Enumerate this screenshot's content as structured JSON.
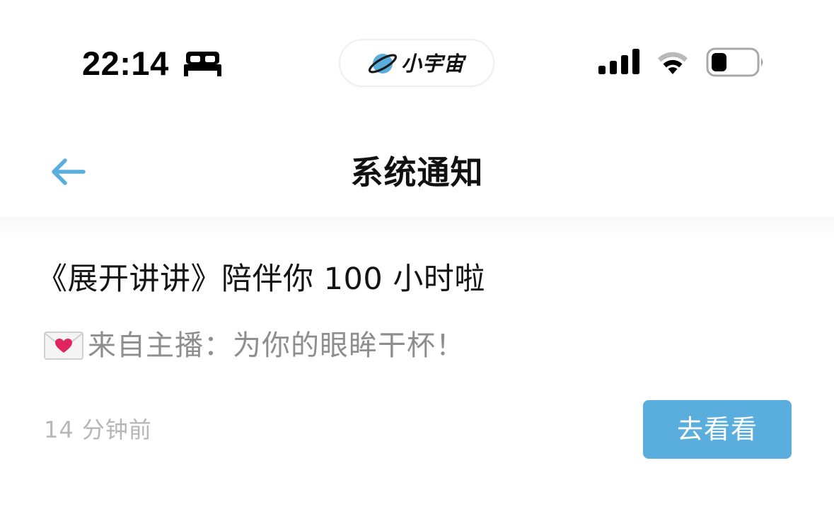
{
  "status_bar": {
    "time": "22:14",
    "focus_icon": "bed-icon",
    "signal_icon": "cellular-signal-icon",
    "wifi_icon": "wifi-icon",
    "battery_icon": "battery-low-icon"
  },
  "island": {
    "app_name": "小宇宙",
    "logo_icon": "planet-icon"
  },
  "nav": {
    "back_icon": "arrow-left-icon",
    "title": "系统通知"
  },
  "notification": {
    "title": "《展开讲讲》陪伴你 100 小时啦",
    "emoji_icon": "love-letter-icon",
    "body": "来自主播：为你的眼眸干杯！",
    "time": "14 分钟前",
    "action_label": "去看看"
  },
  "colors": {
    "accent": "#5aaedd",
    "back_arrow": "#5aaedd",
    "secondary_text": "#8e8e8e",
    "timestamp_text": "#b6b6b6"
  }
}
